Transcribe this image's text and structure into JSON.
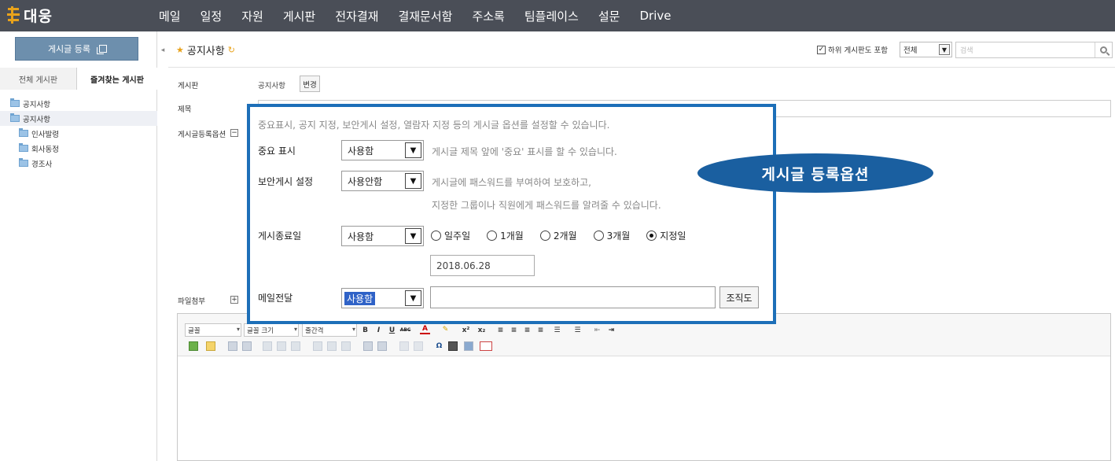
{
  "app": {
    "logo_text": "대웅"
  },
  "nav": {
    "items": [
      "메일",
      "일정",
      "자원",
      "게시판",
      "전자결재",
      "결재문서함",
      "주소록",
      "팀플레이스",
      "설문",
      "Drive"
    ]
  },
  "sidebar": {
    "write_button": "게시글 등록",
    "tabs": [
      {
        "label": "전체 게시판",
        "active": false
      },
      {
        "label": "즐겨찾는 게시판",
        "active": true
      }
    ],
    "tree": [
      {
        "label": "공지사항",
        "level": 0,
        "selected": false
      },
      {
        "label": "공지사항",
        "level": 0,
        "selected": true
      },
      {
        "label": "인사발령",
        "level": 1,
        "selected": false
      },
      {
        "label": "회사동정",
        "level": 1,
        "selected": false
      },
      {
        "label": "경조사",
        "level": 1,
        "selected": false
      }
    ]
  },
  "header": {
    "title": "공지사항",
    "include_sub_label": "하위 게시판도 포함",
    "include_sub_checked": true,
    "scope_value": "전체",
    "search_placeholder": "검색"
  },
  "form": {
    "board_label": "게시판",
    "board_value": "공지사항",
    "change_button": "변경",
    "title_label": "제목",
    "options_label": "게시글등록옵션",
    "attach_label": "파일첨부"
  },
  "options": {
    "description": "중요표시, 공지 지정, 보안게시 설정, 열람자 지정 등의 게시글 옵션를 설정할 수 있습니다.",
    "important": {
      "label": "중요 표시",
      "value": "사용함",
      "help": "게시글 제목 앞에 '중요' 표시를 할 수 있습니다."
    },
    "secure": {
      "label": "보안게시 설정",
      "value": "사용안함",
      "help1": "게시글에 패스워드를 부여하여 보호하고,",
      "help2": "지정한 그룹이나 직원에게 패스워드를 알려줄 수 있습니다."
    },
    "end_date": {
      "label": "게시종료일",
      "value": "사용함",
      "radios": [
        {
          "label": "일주일",
          "checked": false
        },
        {
          "label": "1개월",
          "checked": false
        },
        {
          "label": "2개월",
          "checked": false
        },
        {
          "label": "3개월",
          "checked": false
        },
        {
          "label": "지정일",
          "checked": true
        }
      ],
      "date": "2018.06.28"
    },
    "mail": {
      "label": "메일전달",
      "value": "사용함",
      "org_button": "조직도"
    }
  },
  "editor": {
    "font": "글꼴",
    "font_size": "글꼴 크기",
    "line_height": "줄간격"
  },
  "callout_badge": "게시글 등록옵션",
  "colors": {
    "nav_bg": "#4a4e57",
    "accent": "#1d6fb8",
    "badge": "#1a5fa0",
    "brand": "#e8a21b"
  }
}
